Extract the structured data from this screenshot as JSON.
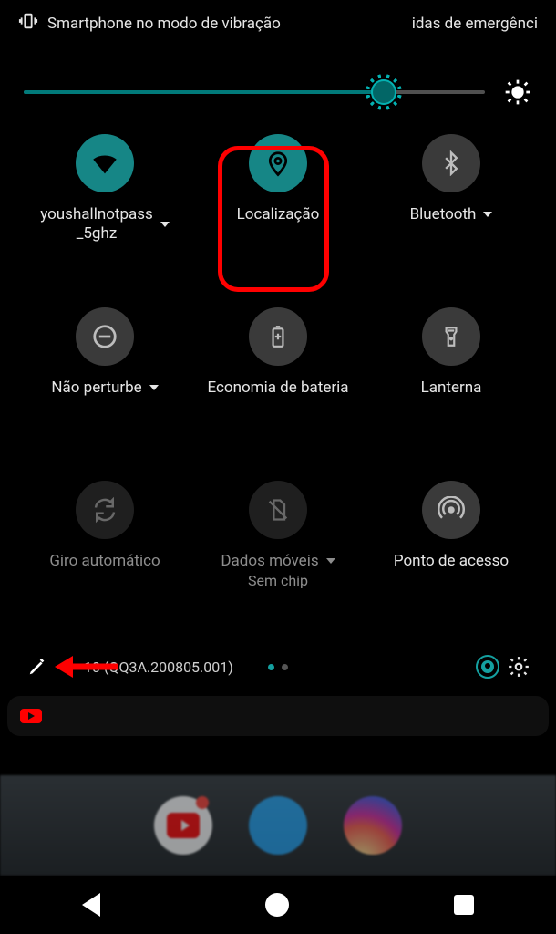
{
  "status": {
    "left_text": "Smartphone no modo de vibração",
    "right_text": "idas de emergênci"
  },
  "brightness": {
    "percent": 78
  },
  "tiles": [
    {
      "id": "wifi",
      "label": "youshallnotpass_5ghz",
      "on": true,
      "dropdown": true,
      "dim": false
    },
    {
      "id": "location",
      "label": "Localização",
      "on": true,
      "dropdown": false,
      "dim": false,
      "highlighted": true
    },
    {
      "id": "bluetooth",
      "label": "Bluetooth",
      "on": false,
      "dropdown": true,
      "dim": false
    },
    {
      "id": "dnd",
      "label": "Não perturbe",
      "on": false,
      "dropdown": true,
      "dim": false
    },
    {
      "id": "battery",
      "label": "Economia de bateria",
      "on": false,
      "dropdown": false,
      "dim": false
    },
    {
      "id": "flashlight",
      "label": "Lanterna",
      "on": false,
      "dropdown": false,
      "dim": false
    },
    {
      "id": "rotate",
      "label": "Giro automático",
      "on": false,
      "dropdown": false,
      "dim": true
    },
    {
      "id": "mobiledata",
      "label": "Dados móveis",
      "sub": "Sem chip",
      "on": false,
      "dropdown": true,
      "dim": true
    },
    {
      "id": "hotspot",
      "label": "Ponto de acesso",
      "on": false,
      "dropdown": false,
      "dim": false
    }
  ],
  "footer": {
    "build": "10 (QQ3A.200805.001)",
    "pages": 2,
    "active_page": 0
  }
}
